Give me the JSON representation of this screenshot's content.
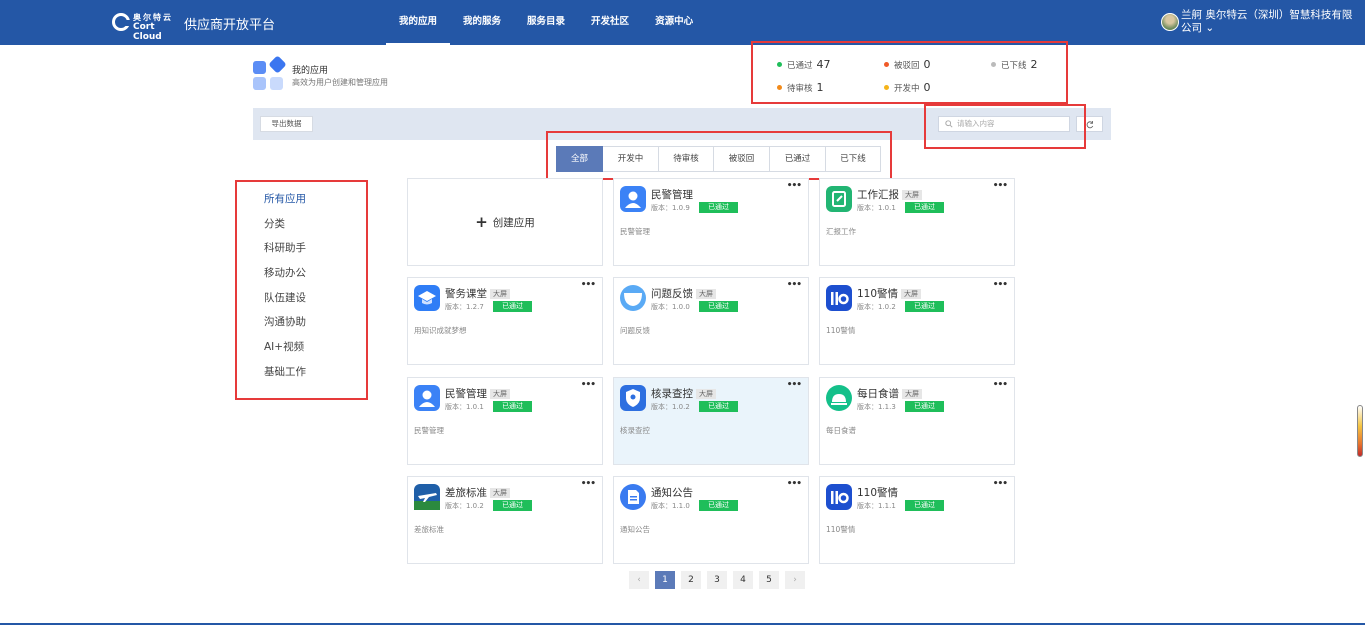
{
  "header": {
    "logo_cn": "奥尔特云",
    "logo_en": "Cort Cloud",
    "title": "供应商开放平台",
    "nav": [
      "我的应用",
      "我的服务",
      "服务目录",
      "开发社区",
      "资源中心"
    ],
    "user": "兰舸 奥尔特云（深圳）智慧科技有限公司"
  },
  "summary": {
    "title": "我的应用",
    "subtitle": "高效为用户创建和管理应用",
    "stats": [
      {
        "label": "已通过",
        "count": "47",
        "color": "#1fbe5a"
      },
      {
        "label": "被驳回",
        "count": "0",
        "color": "#f05a28"
      },
      {
        "label": "已下线",
        "count": "2",
        "color": "#bbbbbb"
      },
      {
        "label": "待审核",
        "count": "1",
        "color": "#f28a1a"
      },
      {
        "label": "开发中",
        "count": "0",
        "color": "#f5b41a"
      }
    ]
  },
  "toolbar": {
    "export_label": "导出数据",
    "search_placeholder": "请输入内容"
  },
  "tabs": [
    "全部",
    "开发中",
    "待审核",
    "被驳回",
    "已通过",
    "已下线"
  ],
  "sidebar": [
    "所有应用",
    "分类",
    "科研助手",
    "移动办公",
    "队伍建设",
    "沟通协助",
    "AI+视频",
    "基础工作"
  ],
  "create_label": "创建应用",
  "status_passed": "已通过",
  "tag_big": "大屏",
  "cards": [
    {
      "name": "民警管理",
      "version": "版本：1.0.9",
      "desc": "民警管理",
      "tag": false,
      "icon": "police-person-icon"
    },
    {
      "name": "工作汇报",
      "version": "版本：1.0.1",
      "desc": "汇报工作",
      "tag": true,
      "icon": "report-icon"
    },
    {
      "name": "警务课堂",
      "version": "版本：1.2.7",
      "desc": "用知识成就梦想",
      "tag": true,
      "icon": "graduation-cap-icon"
    },
    {
      "name": "问题反馈",
      "version": "版本：1.0.0",
      "desc": "问题反馈",
      "tag": true,
      "icon": "feedback-icon"
    },
    {
      "name": "110警情",
      "version": "版本：1.0.2",
      "desc": "110警情",
      "tag": true,
      "icon": "110-icon"
    },
    {
      "name": "民警管理",
      "version": "版本：1.0.1",
      "desc": "民警管理",
      "tag": true,
      "icon": "police-person-icon"
    },
    {
      "name": "核录查控",
      "version": "版本：1.0.2",
      "desc": "核录查控",
      "tag": true,
      "icon": "shield-icon"
    },
    {
      "name": "每日食谱",
      "version": "版本：1.1.3",
      "desc": "每日食谱",
      "tag": true,
      "icon": "food-cover-icon"
    },
    {
      "name": "差旅标准",
      "version": "版本：1.0.2",
      "desc": "差旅标准",
      "tag": true,
      "icon": "airplane-icon"
    },
    {
      "name": "通知公告",
      "version": "版本：1.1.0",
      "desc": "通知公告",
      "tag": false,
      "icon": "document-icon"
    },
    {
      "name": "110警情",
      "version": "版本：1.1.1",
      "desc": "110警情",
      "tag": false,
      "icon": "110-icon"
    }
  ],
  "pagination": {
    "prev": "‹",
    "next": "›",
    "pages": [
      "1",
      "2",
      "3",
      "4",
      "5"
    ],
    "current": "1"
  }
}
